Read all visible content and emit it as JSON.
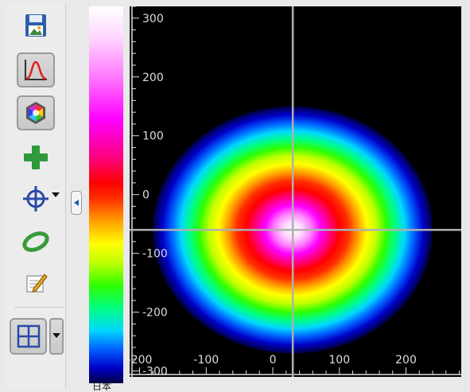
{
  "toolbar": {
    "buttons": [
      {
        "id": "save-image",
        "icon": "save-image-icon",
        "pressed": false
      },
      {
        "id": "profile",
        "icon": "bell-curve-icon",
        "pressed": true
      },
      {
        "id": "color-palette",
        "icon": "color-wheel-icon",
        "pressed": true
      },
      {
        "id": "add",
        "icon": "plus-icon",
        "pressed": false
      },
      {
        "id": "crosshair",
        "icon": "crosshair-icon",
        "pressed": false,
        "has_dropdown": true
      },
      {
        "id": "ellipse",
        "icon": "ellipse-icon",
        "pressed": false
      },
      {
        "id": "annotate",
        "icon": "pencil-icon",
        "pressed": false
      },
      {
        "id": "grid",
        "icon": "grid-icon",
        "pressed": true,
        "has_dropdown": true
      }
    ]
  },
  "colorbar": {
    "label": "日本",
    "colors": [
      "#000040",
      "#0000c8",
      "#0060ff",
      "#00d8ff",
      "#00ff80",
      "#30ff00",
      "#c0ff00",
      "#ffff00",
      "#ffa000",
      "#ff3000",
      "#ff0000",
      "#ff0080",
      "#ff00ff",
      "#ff80ff",
      "#ffd8ff",
      "#ffffff"
    ]
  },
  "chart_data": {
    "type": "heatmap",
    "title": "",
    "xlabel": "",
    "ylabel": "",
    "xlim": [
      -215,
      283
    ],
    "ylim": [
      -310,
      320
    ],
    "x_ticks": [
      {
        "value": -200,
        "label": "-200"
      },
      {
        "value": -100,
        "label": "-100"
      },
      {
        "value": 0,
        "label": "0"
      },
      {
        "value": 100,
        "label": "100"
      },
      {
        "value": 200,
        "label": "200"
      }
    ],
    "y_ticks": [
      {
        "value": 300,
        "label": "300"
      },
      {
        "value": 200,
        "label": "200"
      },
      {
        "value": 100,
        "label": "100"
      },
      {
        "value": 0,
        "label": "0"
      },
      {
        "value": -100,
        "label": "-100"
      },
      {
        "value": -200,
        "label": "-200"
      },
      {
        "value": -300,
        "label": "-300"
      }
    ],
    "beam": {
      "center_x": 30,
      "center_y": -60,
      "radius": 210
    },
    "crosshair": {
      "x": 30,
      "y": -60
    },
    "background": "#000000",
    "axis_color": "#dddddd",
    "crosshair_color": "#b0b0b0"
  }
}
